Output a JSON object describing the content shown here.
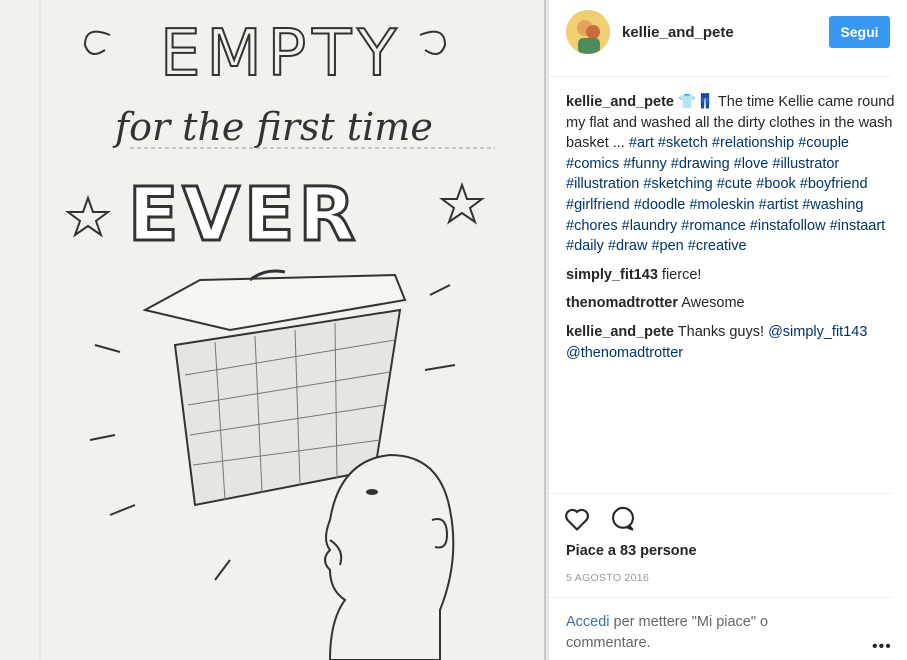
{
  "post": {
    "image_title_top": "EMPTY",
    "image_title_middle": "for the first time",
    "image_title_bottom": "EVER"
  },
  "header": {
    "username": "kellie_and_pete",
    "follow_label": "Segui"
  },
  "caption": {
    "user": "kellie_and_pete",
    "emoji": "👕👖",
    "text": " The time Kellie came round my flat and washed all the dirty clothes in the wash basket ...",
    "hashtags": [
      "#art",
      "#sketch",
      "#relationship",
      "#couple",
      "#comics",
      "#funny",
      "#drawing",
      "#love",
      "#illustrator",
      "#illustration",
      "#sketching",
      "#cute",
      "#book",
      "#boyfriend",
      "#girlfriend",
      "#doodle",
      "#moleskin",
      "#artist",
      "#washing",
      "#chores",
      "#laundry",
      "#romance",
      "#instafollow",
      "#instaart",
      "#daily",
      "#draw",
      "#pen",
      "#creative"
    ]
  },
  "comments": [
    {
      "user": "simply_fit143",
      "text": "fierce!"
    },
    {
      "user": "thenomadtrotter",
      "text": "Awesome"
    },
    {
      "user": "kellie_and_pete",
      "text": "Thanks guys!",
      "mentions": [
        "@simply_fit143",
        "@thenomadtrotter"
      ]
    }
  ],
  "actions": {
    "like_icon": "heart-outline-icon",
    "comment_icon": "speech-bubble-icon"
  },
  "likes_text": "Piace a 83 persone",
  "date": "5 AGOSTO 2016",
  "login": {
    "link": "Accedi",
    "rest": " per mettere \"Mi piace\" o commentare."
  },
  "more_label": "•••",
  "colors": {
    "follow_button": "#3897f0",
    "hashtag": "#003569",
    "login_link": "#3f729b"
  }
}
